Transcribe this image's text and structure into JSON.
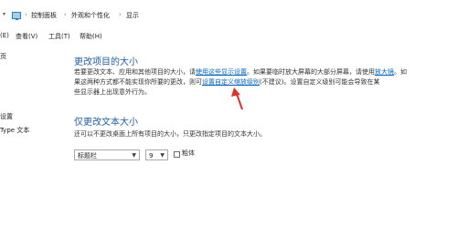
{
  "breadcrumb": {
    "items": [
      "控制面板",
      "外观和个性化",
      "显示"
    ]
  },
  "menu": {
    "items": [
      "(E)",
      "查看(V)",
      "工具(T)",
      "帮助(H)"
    ]
  },
  "sidebar": {
    "items": [
      "页",
      "设置",
      "Type 文本"
    ]
  },
  "section1": {
    "title": "更改项目的大小",
    "line1_a": "若要更改文本、应用和其他项目的大小，请",
    "line1_link": "使用这些显示设置",
    "line1_b": "。如果要临时放大屏幕的大部分屏幕，请使用",
    "line1_link2": "放大镜",
    "line1_c": "。如",
    "line2_a": "果这两种方式都不能实现你所要的更改，则可",
    "line2_link": "设置自定义缩放级别",
    "line2_b": "(不建议)。设置自定义级别可能会导致在某",
    "line3": "些显示器上出现意外行为。"
  },
  "section2": {
    "title": "仅更改文本大小",
    "description": "还可以不更改桌面上所有项目的大小，只更改指定项目的文本大小。",
    "item_select": "标题栏",
    "size_select": "9",
    "bold_label": "粗体"
  },
  "colors": {
    "heading": "#1e5ea8",
    "link": "#0066cc",
    "annotation_arrow": "#e0312a"
  }
}
